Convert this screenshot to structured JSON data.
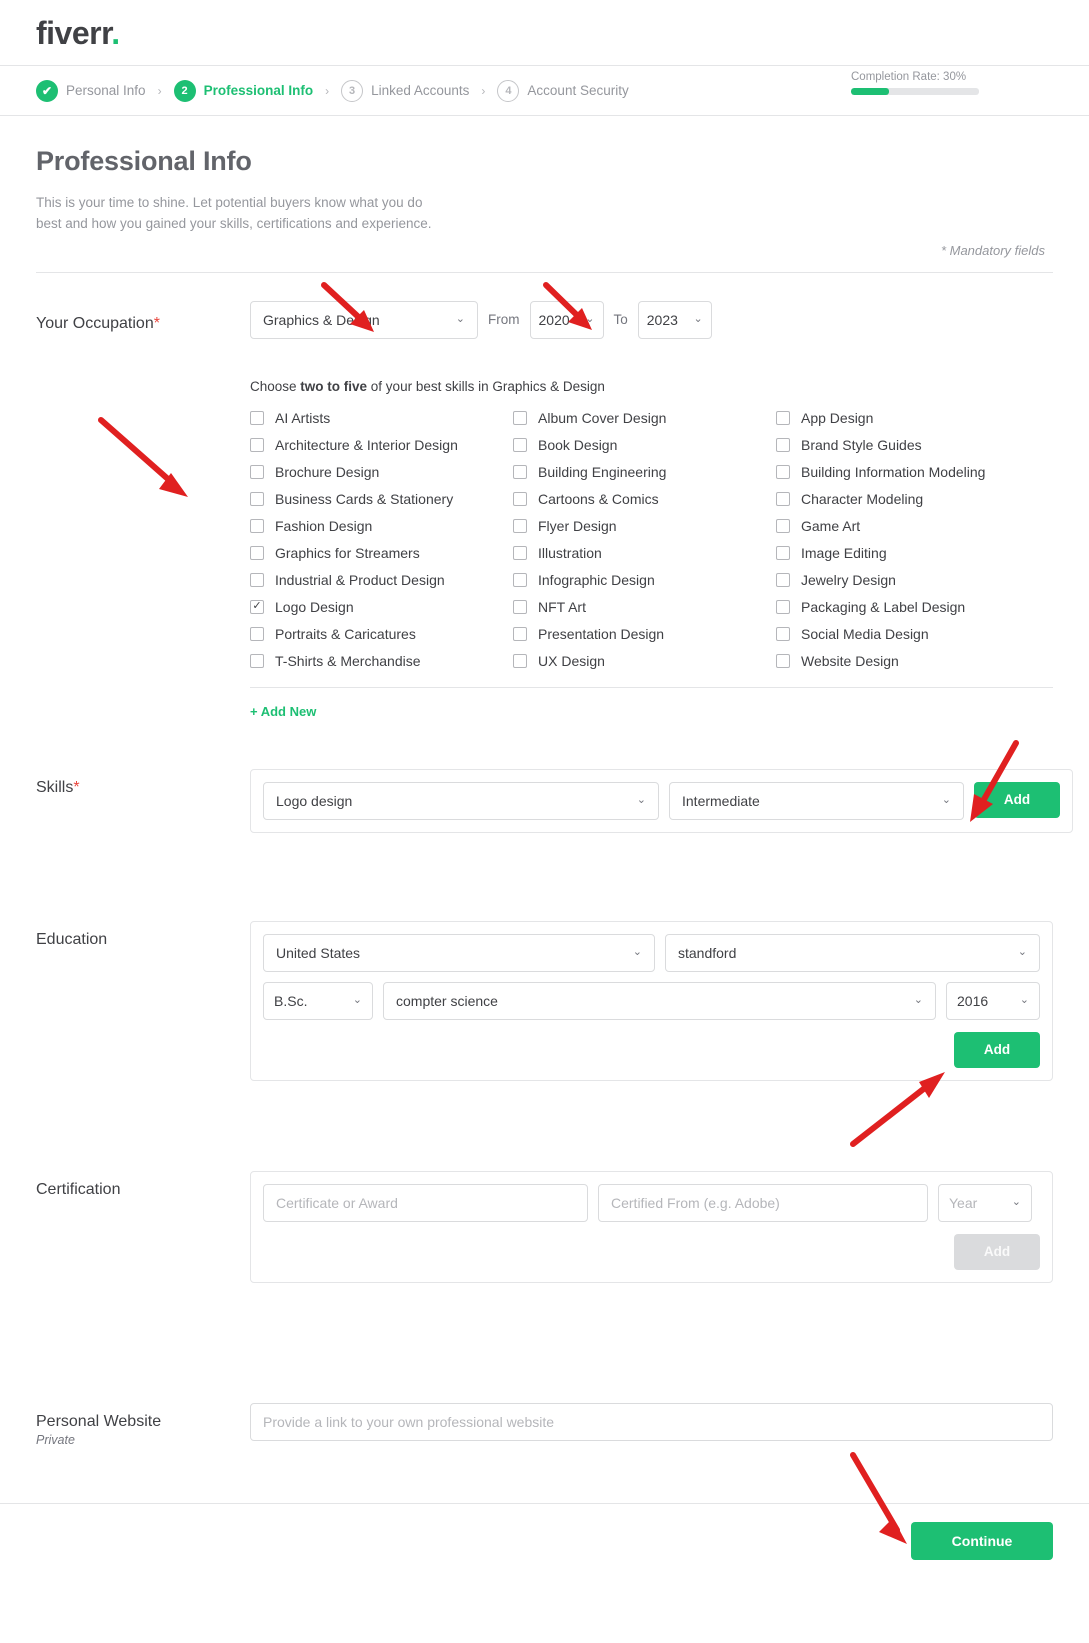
{
  "brand": {
    "name": "fiverr",
    "dot": ".",
    "accent": "#1dbf73"
  },
  "steps": [
    {
      "badge": "✔",
      "label": "Personal Info",
      "state": "done"
    },
    {
      "badge": "2",
      "label": "Professional Info",
      "state": "active"
    },
    {
      "badge": "3",
      "label": "Linked Accounts",
      "state": "idle"
    },
    {
      "badge": "4",
      "label": "Account Security",
      "state": "idle"
    }
  ],
  "step_separator": "›",
  "completion": {
    "text": "Completion Rate: 30%",
    "percent": 30
  },
  "page": {
    "title": "Professional Info",
    "intro": "This is your time to shine. Let potential buyers know what you do best and how you gained your skills, certifications and experience.",
    "mandatory_note": "* Mandatory fields"
  },
  "occupation": {
    "label": "Your Occupation",
    "required_mark": "*",
    "value": "Graphics & Design",
    "from_label": "From",
    "from_value": "2020",
    "to_label": "To",
    "to_value": "2023"
  },
  "skills_picker": {
    "prompt_prefix": "Choose ",
    "prompt_bold": "two to five",
    "prompt_suffix": " of your best skills in Graphics & Design",
    "add_new_label": "+ Add New",
    "options": [
      {
        "label": "AI Artists",
        "checked": false
      },
      {
        "label": "Album Cover Design",
        "checked": false
      },
      {
        "label": "App Design",
        "checked": false
      },
      {
        "label": "Architecture & Interior Design",
        "checked": false
      },
      {
        "label": "Book Design",
        "checked": false
      },
      {
        "label": "Brand Style Guides",
        "checked": false
      },
      {
        "label": "Brochure Design",
        "checked": false
      },
      {
        "label": "Building Engineering",
        "checked": false
      },
      {
        "label": "Building Information Modeling",
        "checked": false
      },
      {
        "label": "Business Cards & Stationery",
        "checked": false
      },
      {
        "label": "Cartoons & Comics",
        "checked": false
      },
      {
        "label": "Character Modeling",
        "checked": false
      },
      {
        "label": "Fashion Design",
        "checked": false
      },
      {
        "label": "Flyer Design",
        "checked": false
      },
      {
        "label": "Game Art",
        "checked": false
      },
      {
        "label": "Graphics for Streamers",
        "checked": false
      },
      {
        "label": "Illustration",
        "checked": false
      },
      {
        "label": "Image Editing",
        "checked": false
      },
      {
        "label": "Industrial & Product Design",
        "checked": false
      },
      {
        "label": "Infographic Design",
        "checked": false
      },
      {
        "label": "Jewelry Design",
        "checked": false
      },
      {
        "label": "Logo Design",
        "checked": true
      },
      {
        "label": "NFT Art",
        "checked": false
      },
      {
        "label": "Packaging & Label Design",
        "checked": false
      },
      {
        "label": "Portraits & Caricatures",
        "checked": false
      },
      {
        "label": "Presentation Design",
        "checked": false
      },
      {
        "label": "Social Media Design",
        "checked": false
      },
      {
        "label": "T-Shirts & Merchandise",
        "checked": false
      },
      {
        "label": "UX Design",
        "checked": false
      },
      {
        "label": "Website Design",
        "checked": false
      }
    ]
  },
  "skills": {
    "label": "Skills",
    "required_mark": "*",
    "name_value": "Logo design",
    "level_value": "Intermediate",
    "add_label": "Add"
  },
  "education": {
    "label": "Education",
    "country_value": "United States",
    "school_value": "standford",
    "degree_value": "B.Sc.",
    "major_value": "compter science",
    "year_value": "2016",
    "add_label": "Add"
  },
  "certification": {
    "label": "Certification",
    "name_placeholder": "Certificate or Award",
    "from_placeholder": "Certified From (e.g. Adobe)",
    "year_placeholder": "Year",
    "add_label": "Add"
  },
  "website": {
    "label": "Personal Website",
    "privacy_note": "Private",
    "placeholder": "Provide a link to your own professional website"
  },
  "footer": {
    "continue_label": "Continue"
  },
  "icons": {
    "chevron_down": "⌄",
    "check": "✓"
  },
  "annotations": {
    "arrow_color": "#e02020",
    "count": 5
  }
}
